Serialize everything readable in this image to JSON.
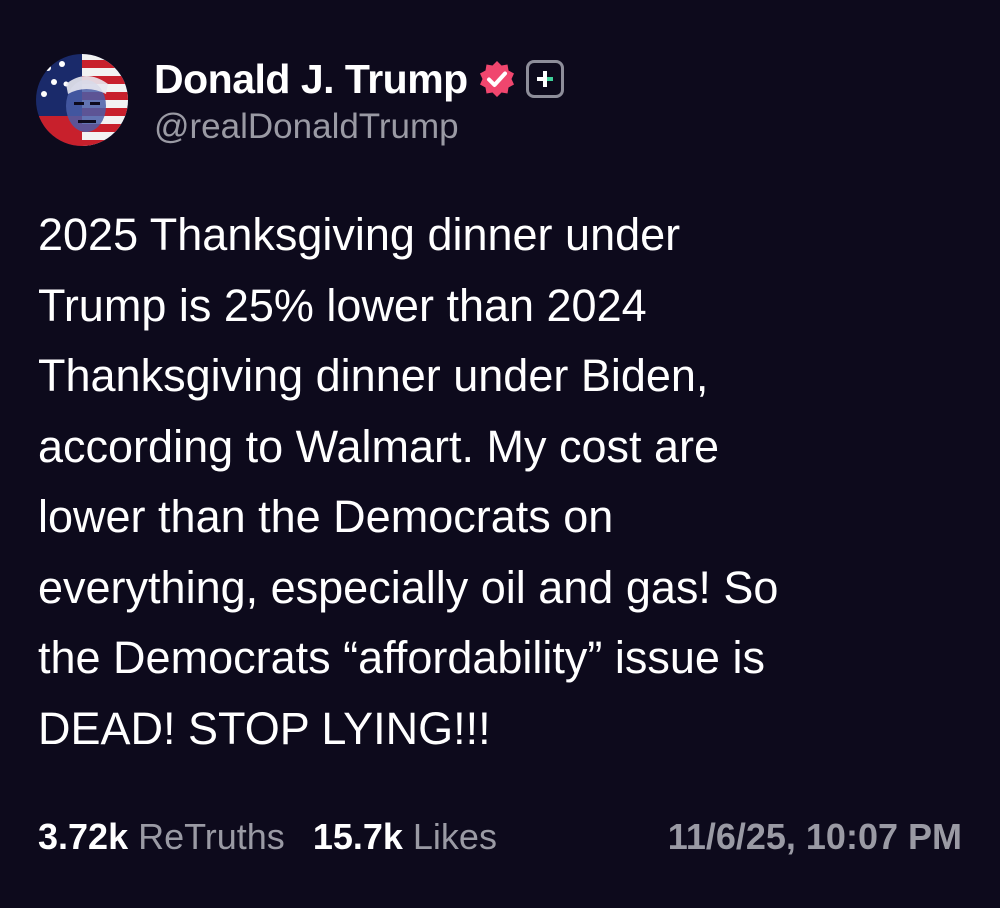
{
  "author": {
    "display_name": "Donald J. Trump",
    "handle": "@realDonaldTrump",
    "verified_icon": "verified-badge-icon",
    "plus_icon": "plus-icon"
  },
  "post": {
    "text": "2025 Thanksgiving dinner under\nTrump is 25% lower than 2024\nThanksgiving dinner under Biden,\naccording to Walmart. My cost are\nlower than the Democrats on\neverything, especially oil and gas! So\nthe Democrats “affordability” issue is\nDEAD! STOP LYING!!!"
  },
  "stats": {
    "retruths_count": "3.72k",
    "retruths_label": "ReTruths",
    "likes_count": "15.7k",
    "likes_label": "Likes",
    "timestamp": "11/6/25, 10:07 PM"
  },
  "colors": {
    "background": "#0d0a1c",
    "verified_badge": "#f0466e",
    "muted_text": "#9a9aa4"
  }
}
